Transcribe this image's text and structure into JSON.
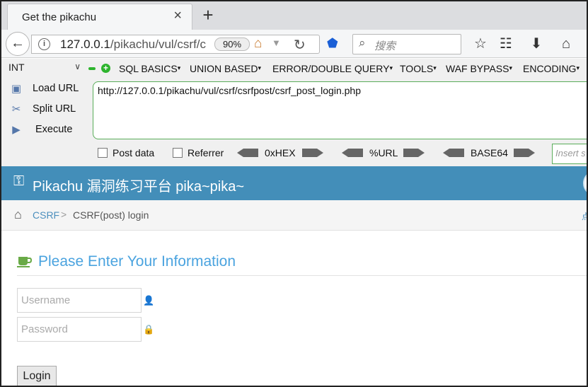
{
  "browser": {
    "tab_title": "Get the pikachu",
    "tab_close": "×",
    "new_tab": "+",
    "url_host": "127.0.0.1",
    "url_path": "/pikachu/vul/csrf/c",
    "zoom": "90%",
    "search_placeholder": "搜索"
  },
  "hackbar": {
    "int_select": "INT",
    "menu": [
      "SQL BASICS",
      "UNION BASED",
      "ERROR/DOUBLE QUERY",
      "TOOLS",
      "WAF BYPASS",
      "ENCODING"
    ],
    "load_url": "Load URL",
    "split_url": "Split URL",
    "execute": "Execute",
    "textarea_value": "http://127.0.0.1/pikachu/vul/csrf/csrfpost/csrf_post_login.php",
    "post_data": "Post data",
    "referrer": "Referrer",
    "enc_hex": "0xHEX",
    "enc_url": "%URL",
    "enc_base64": "BASE64",
    "insert_placeholder": "Insert s"
  },
  "site": {
    "title": "Pikachu 漏洞练习平台 pika~pika~",
    "breadcrumb_link": "CSRF",
    "breadcrumb_sep": ">",
    "breadcrumb_current": "CSRF(post) login",
    "breadcrumb_edge": "点",
    "heading": "Please Enter Your Information",
    "username_placeholder": "Username",
    "password_placeholder": "Password",
    "login_label": "Login",
    "header_color": "#438eb9",
    "accent_color": "#4aa3df"
  }
}
